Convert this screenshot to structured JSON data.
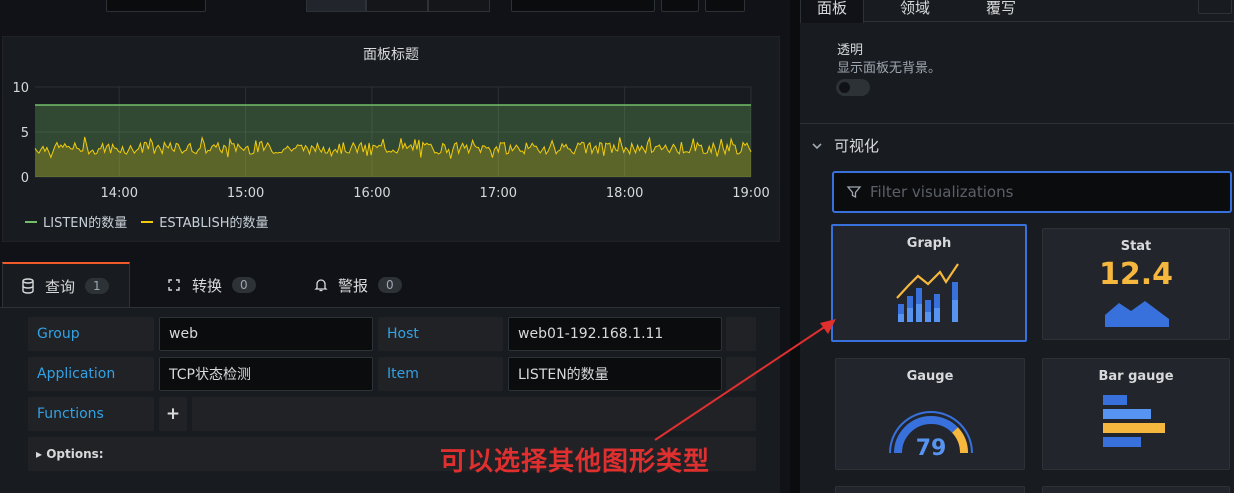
{
  "panel": {
    "title": "面板标题",
    "legend": [
      {
        "label": "LISTEN的数量",
        "color": "#73bf69"
      },
      {
        "label": "ESTABLISH的数量",
        "color": "#f2cc0c"
      }
    ]
  },
  "chart_data": {
    "type": "line",
    "x_ticks": [
      "14:00",
      "15:00",
      "16:00",
      "17:00",
      "18:00",
      "19:00"
    ],
    "y_ticks": [
      0,
      5,
      10
    ],
    "ylim": [
      0,
      10
    ],
    "series": [
      {
        "name": "LISTEN的数量",
        "color": "#73bf69",
        "constant": 8,
        "fill": true
      },
      {
        "name": "ESTABLISH的数量",
        "color": "#f2cc0c",
        "range": [
          1.9,
          4.5
        ],
        "typical": 3.0,
        "fill": true
      }
    ],
    "grid": true
  },
  "tabs": [
    {
      "label": "查询",
      "count": "1",
      "icon": "database-icon"
    },
    {
      "label": "转换",
      "count": "0",
      "icon": "transform-icon"
    },
    {
      "label": "警报",
      "count": "0",
      "icon": "bell-icon"
    }
  ],
  "query": {
    "group_label": "Group",
    "group_value": "web",
    "host_label": "Host",
    "host_value": "web01-192.168.1.11",
    "application_label": "Application",
    "application_value": "TCP状态检测",
    "item_label": "Item",
    "item_value": "LISTEN的数量",
    "functions_label": "Functions",
    "plus": "+",
    "options_label": "▸ Options:"
  },
  "annotation": "可以选择其他图形类型",
  "right": {
    "tabs": [
      "面板",
      "领域",
      "覆写"
    ],
    "transparent_title": "透明",
    "transparent_desc": "显示面板无背景。",
    "section_title": "可视化",
    "filter_placeholder": "Filter visualizations",
    "cards": [
      {
        "name": "Graph"
      },
      {
        "name": "Stat",
        "value": "12.4"
      },
      {
        "name": "Gauge",
        "value": "79"
      },
      {
        "name": "Bar gauge"
      }
    ]
  },
  "colors": {
    "accent": "#3871dc",
    "tab_active": "#f05a28",
    "annotation": "#e02f2f"
  }
}
